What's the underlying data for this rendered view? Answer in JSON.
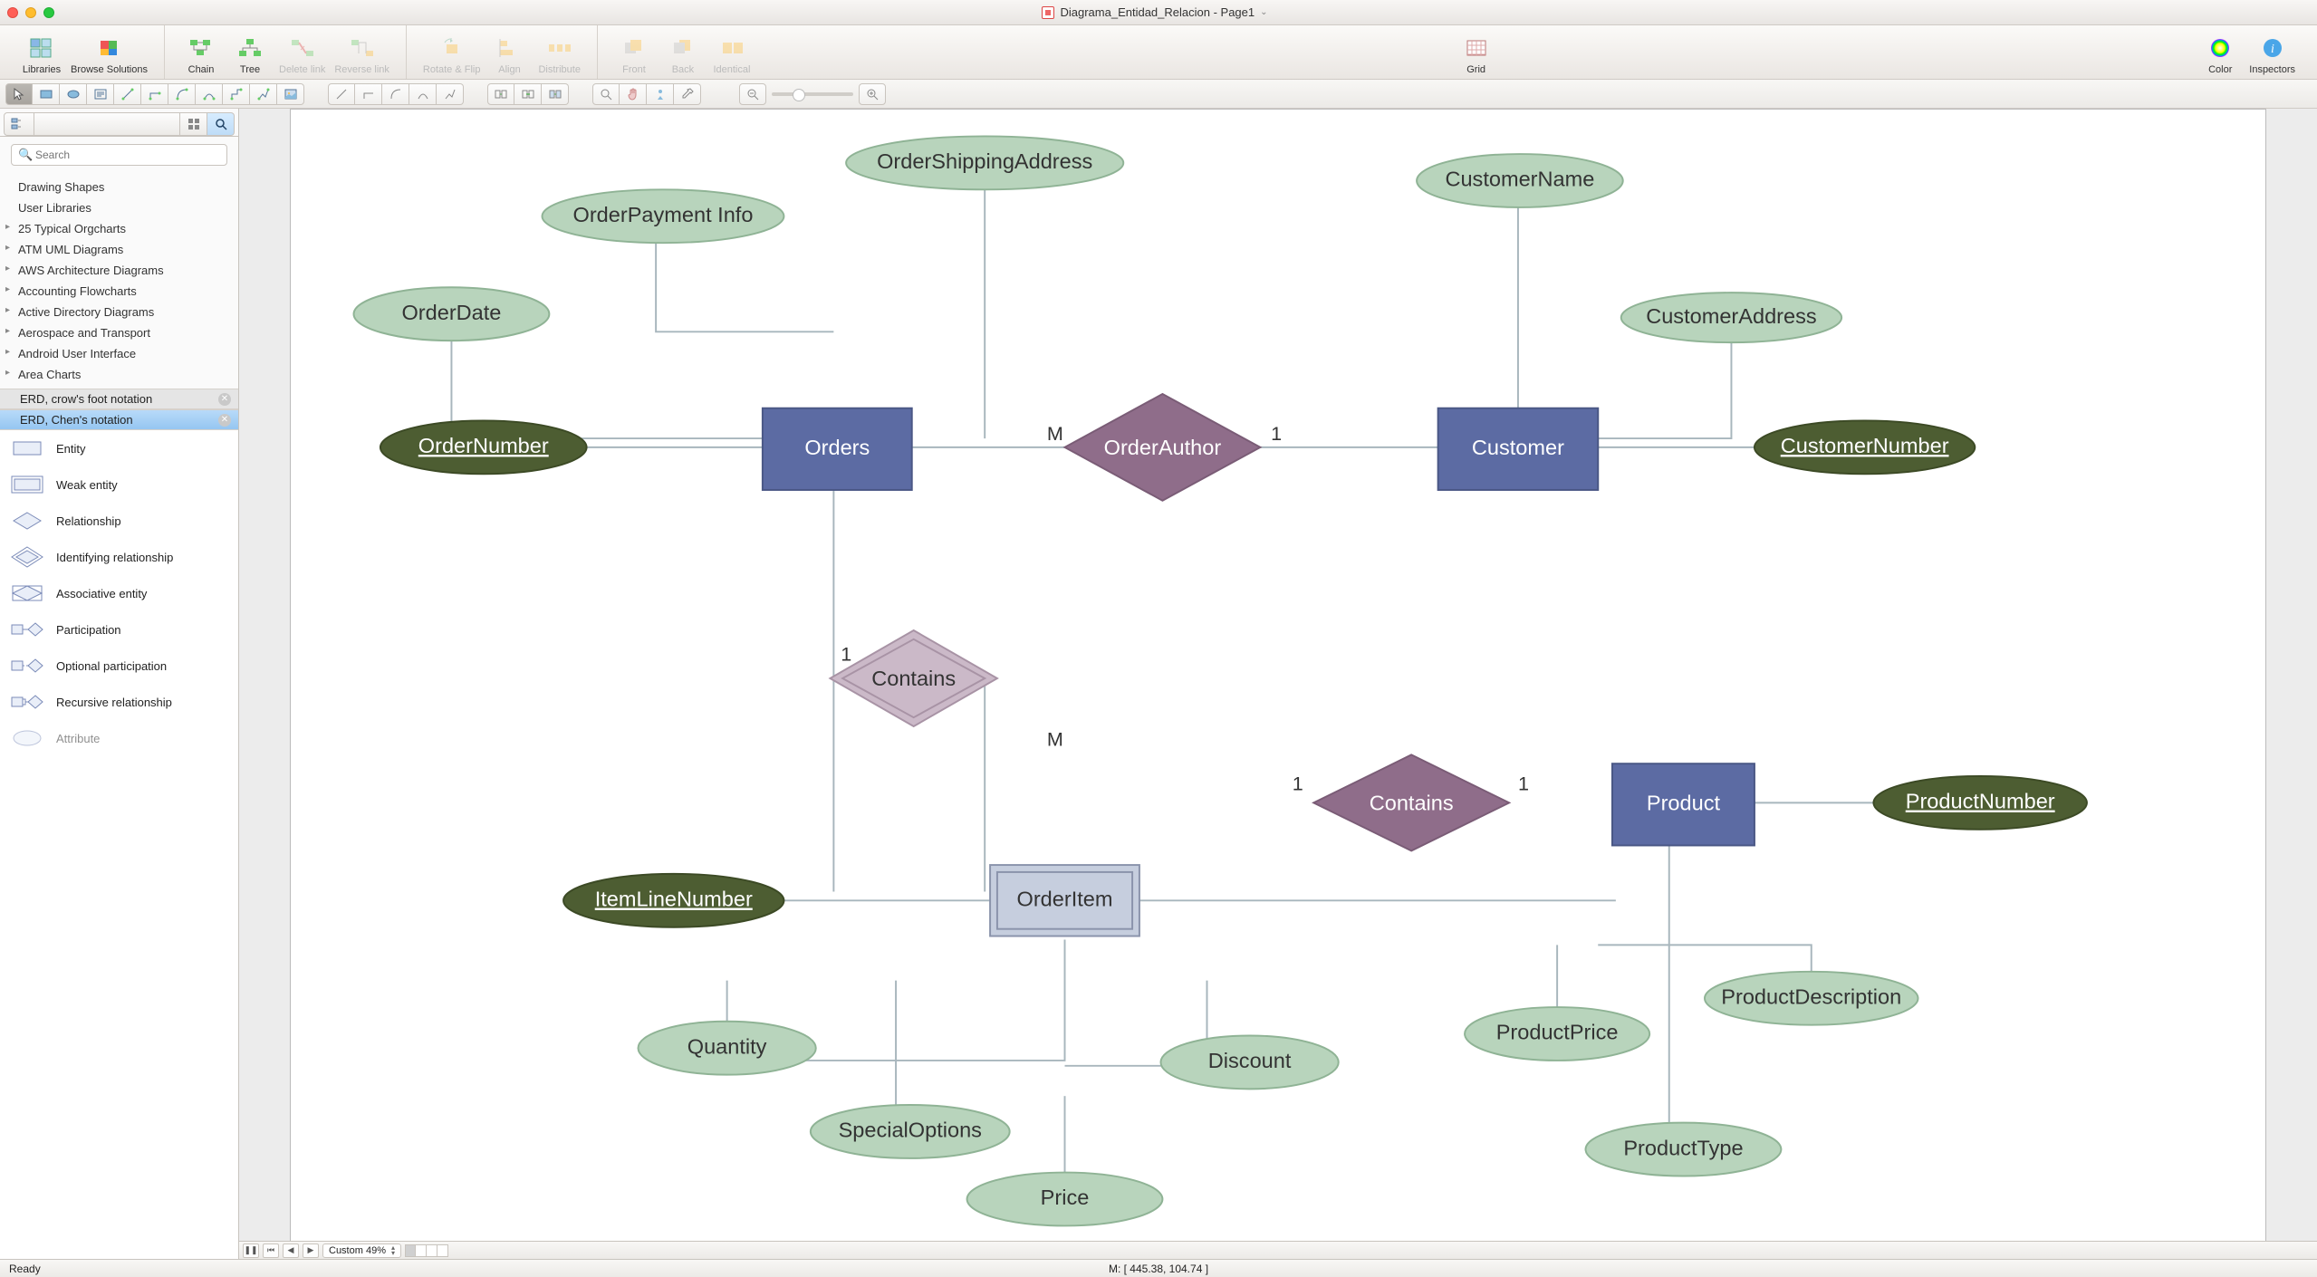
{
  "window": {
    "title": "Diagrama_Entidad_Relacion - Page1"
  },
  "toolbar_main": {
    "libraries": "Libraries",
    "browse_solutions": "Browse Solutions",
    "chain": "Chain",
    "tree": "Tree",
    "delete_link": "Delete link",
    "reverse_link": "Reverse link",
    "rotate_flip": "Rotate & Flip",
    "align": "Align",
    "distribute": "Distribute",
    "front": "Front",
    "back": "Back",
    "identical": "Identical",
    "grid": "Grid",
    "color": "Color",
    "inspectors": "Inspectors"
  },
  "sidebar": {
    "search_placeholder": "Search",
    "categories": [
      "Drawing Shapes",
      "User Libraries",
      "25 Typical Orgcharts",
      "ATM UML Diagrams",
      "AWS Architecture Diagrams",
      "Accounting Flowcharts",
      "Active Directory Diagrams",
      "Aerospace and Transport",
      "Android User Interface",
      "Area Charts"
    ],
    "lib_tabs": {
      "crows_foot": "ERD, crow's foot notation",
      "chen": "ERD, Chen's notation"
    },
    "shapes": [
      "Entity",
      "Weak entity",
      "Relationship",
      "Identifying relationship",
      "Associative entity",
      "Participation",
      "Optional participation",
      "Recursive relationship",
      "Attribute"
    ]
  },
  "pager": {
    "zoom_label": "Custom 49%"
  },
  "status": {
    "ready": "Ready",
    "mouse": "M: [ 445.38, 104.74 ]"
  },
  "diagram": {
    "entities": {
      "orders": "Orders",
      "customer": "Customer",
      "product": "Product",
      "order_item": "OrderItem"
    },
    "relationships": {
      "order_author": "OrderAuthor",
      "contains1": "Contains",
      "contains2": "Contains"
    },
    "attributes": {
      "order_date": "OrderDate",
      "order_payment": "OrderPayment Info",
      "order_shipping": "OrderShippingAddress",
      "order_number": "OrderNumber",
      "customer_name": "CustomerName",
      "customer_address": "CustomerAddress",
      "customer_number": "CustomerNumber",
      "product_number": "ProductNumber",
      "product_price": "ProductPrice",
      "product_description": "ProductDescription",
      "product_type": "ProductType",
      "item_line_number": "ItemLineNumber",
      "quantity": "Quantity",
      "special_options": "SpecialOptions",
      "price": "Price",
      "discount": "Discount"
    },
    "cardinalities": {
      "m1": "M",
      "one1": "1",
      "one2": "1",
      "m2": "M",
      "one3": "1",
      "one4": "1"
    }
  }
}
